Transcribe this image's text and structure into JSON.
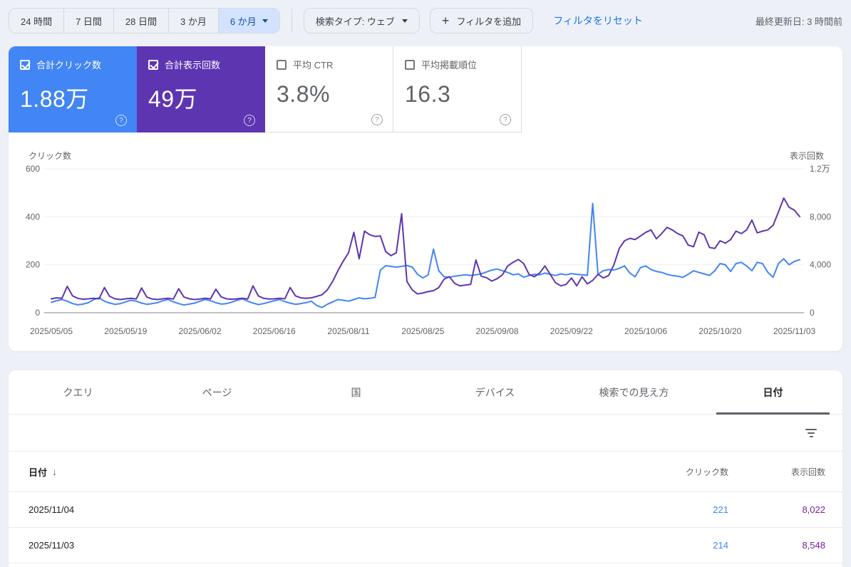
{
  "topbar": {
    "date_ranges": [
      "24 時間",
      "7 日間",
      "28 日間",
      "3 か月"
    ],
    "date_range_selected": "6 か月",
    "search_type": "検索タイプ: ウェブ",
    "add_filter": "フィルタを追加",
    "reset_filters": "フィルタをリセット",
    "last_updated": "最終更新日: 3 時間前"
  },
  "metric_cards": [
    {
      "label": "合計クリック数",
      "value": "1.88万",
      "checked": true,
      "color": "#4285f4"
    },
    {
      "label": "合計表示回数",
      "value": "49万",
      "checked": true,
      "color": "#5e35b1"
    },
    {
      "label": "平均 CTR",
      "value": "3.8%",
      "checked": false,
      "color": ""
    },
    {
      "label": "平均掲載順位",
      "value": "16.3",
      "checked": false,
      "color": ""
    }
  ],
  "chart_data": {
    "type": "line",
    "grid": true,
    "legend_position": "none",
    "left_axis": {
      "title": "クリック数",
      "max": 600,
      "tick_values": [
        0,
        200,
        400,
        600
      ],
      "tick_labels": [
        "0",
        "200",
        "400",
        "600"
      ]
    },
    "right_axis": {
      "title": "表示回数",
      "max": 12000,
      "tick_values": [
        0,
        4000,
        8000,
        12000
      ],
      "tick_labels": [
        "0",
        "4,000",
        "8,000",
        "1.2万"
      ]
    },
    "x_labels": [
      "2025/05/05",
      "2025/05/19",
      "2025/06/02",
      "2025/06/16",
      "2025/08/11",
      "2025/08/25",
      "2025/09/08",
      "2025/09/22",
      "2025/10/06",
      "2025/10/20",
      "2025/11/03"
    ],
    "x_label_days": [
      0,
      14,
      28,
      42,
      56,
      70,
      84,
      98,
      112,
      126,
      140
    ],
    "series": [
      {
        "name": "クリック数",
        "axis": "left",
        "color": "#4285f4",
        "values": [
          43,
          50,
          55,
          48,
          38,
          33,
          36,
          42,
          55,
          62,
          48,
          40,
          35,
          38,
          45,
          52,
          48,
          40,
          35,
          38,
          42,
          50,
          55,
          45,
          38,
          32,
          36,
          40,
          48,
          55,
          50,
          42,
          36,
          38,
          44,
          52,
          58,
          48,
          40,
          34,
          38,
          44,
          50,
          55,
          46,
          40,
          35,
          38,
          42,
          48,
          30,
          22,
          35,
          45,
          55,
          52,
          48,
          55,
          62,
          58,
          60,
          64,
          178,
          196,
          193,
          190,
          193,
          197,
          190,
          160,
          145,
          158,
          265,
          175,
          150,
          148,
          152,
          155,
          158,
          155,
          158,
          162,
          170,
          178,
          182,
          175,
          168,
          158,
          162,
          148,
          155,
          160,
          158,
          165,
          160,
          155,
          162,
          158,
          163,
          160,
          158,
          156,
          455,
          160,
          175,
          180,
          178,
          185,
          195,
          165,
          150,
          188,
          195,
          180,
          172,
          168,
          160,
          155,
          152,
          148,
          160,
          175,
          168,
          162,
          155,
          175,
          205,
          200,
          172,
          205,
          210,
          195,
          175,
          210,
          205,
          168,
          148,
          205,
          225,
          200,
          214,
          221
        ]
      },
      {
        "name": "表示回数",
        "axis": "right",
        "color": "#5e35b1",
        "values": [
          1160,
          1240,
          1200,
          2200,
          1400,
          1200,
          1120,
          1160,
          1200,
          1160,
          2100,
          1360,
          1160,
          1100,
          1160,
          1200,
          1140,
          2060,
          1300,
          1140,
          1100,
          1160,
          1200,
          1140,
          2000,
          1300,
          1160,
          1100,
          1140,
          1200,
          1160,
          1960,
          1320,
          1160,
          1120,
          1160,
          1200,
          1140,
          2240,
          1400,
          1200,
          1140,
          1160,
          1200,
          1160,
          2100,
          1400,
          1240,
          1200,
          1240,
          1360,
          1500,
          1900,
          2600,
          3500,
          4300,
          5000,
          6700,
          4500,
          6800,
          6500,
          6360,
          6400,
          5100,
          4760,
          5000,
          8260,
          2600,
          1900,
          1560,
          1640,
          1760,
          1840,
          2100,
          2800,
          3000,
          2440,
          2240,
          2300,
          2360,
          4400,
          3040,
          2920,
          2640,
          2840,
          3160,
          3900,
          4200,
          4440,
          4100,
          3200,
          3000,
          3300,
          3900,
          3200,
          2500,
          2240,
          2360,
          2900,
          2240,
          3000,
          2400,
          2700,
          3200,
          2900,
          3100,
          4000,
          5360,
          6000,
          6200,
          6100,
          6400,
          6700,
          6900,
          6160,
          6600,
          7120,
          6900,
          6600,
          6400,
          5640,
          5500,
          6720,
          6500,
          5440,
          5360,
          6000,
          5800,
          6100,
          6800,
          6600,
          6900,
          7720,
          6660,
          6800,
          6900,
          7300,
          8400,
          9560,
          8800,
          8548,
          8022
        ]
      }
    ]
  },
  "table_panel": {
    "tabs": [
      "クエリ",
      "ページ",
      "国",
      "デバイス",
      "検索での見え方",
      "日付"
    ],
    "active_tab": "日付",
    "columns": {
      "date": "日付",
      "clicks": "クリック数",
      "impressions": "表示回数"
    },
    "sort_arrow": "↓",
    "rows": [
      {
        "date": "2025/11/04",
        "clicks": "221",
        "impressions": "8,022"
      },
      {
        "date": "2025/11/03",
        "clicks": "214",
        "impressions": "8,548"
      }
    ]
  },
  "colors": {
    "clicks_blue": "#4285f4",
    "impressions_purple": "#5e35b1",
    "table_impressions_text": "#7b1fa2",
    "selected_chip_bg": "#d3e3fd",
    "link_blue": "#1a73e8",
    "page_background": "#edf1f7"
  }
}
